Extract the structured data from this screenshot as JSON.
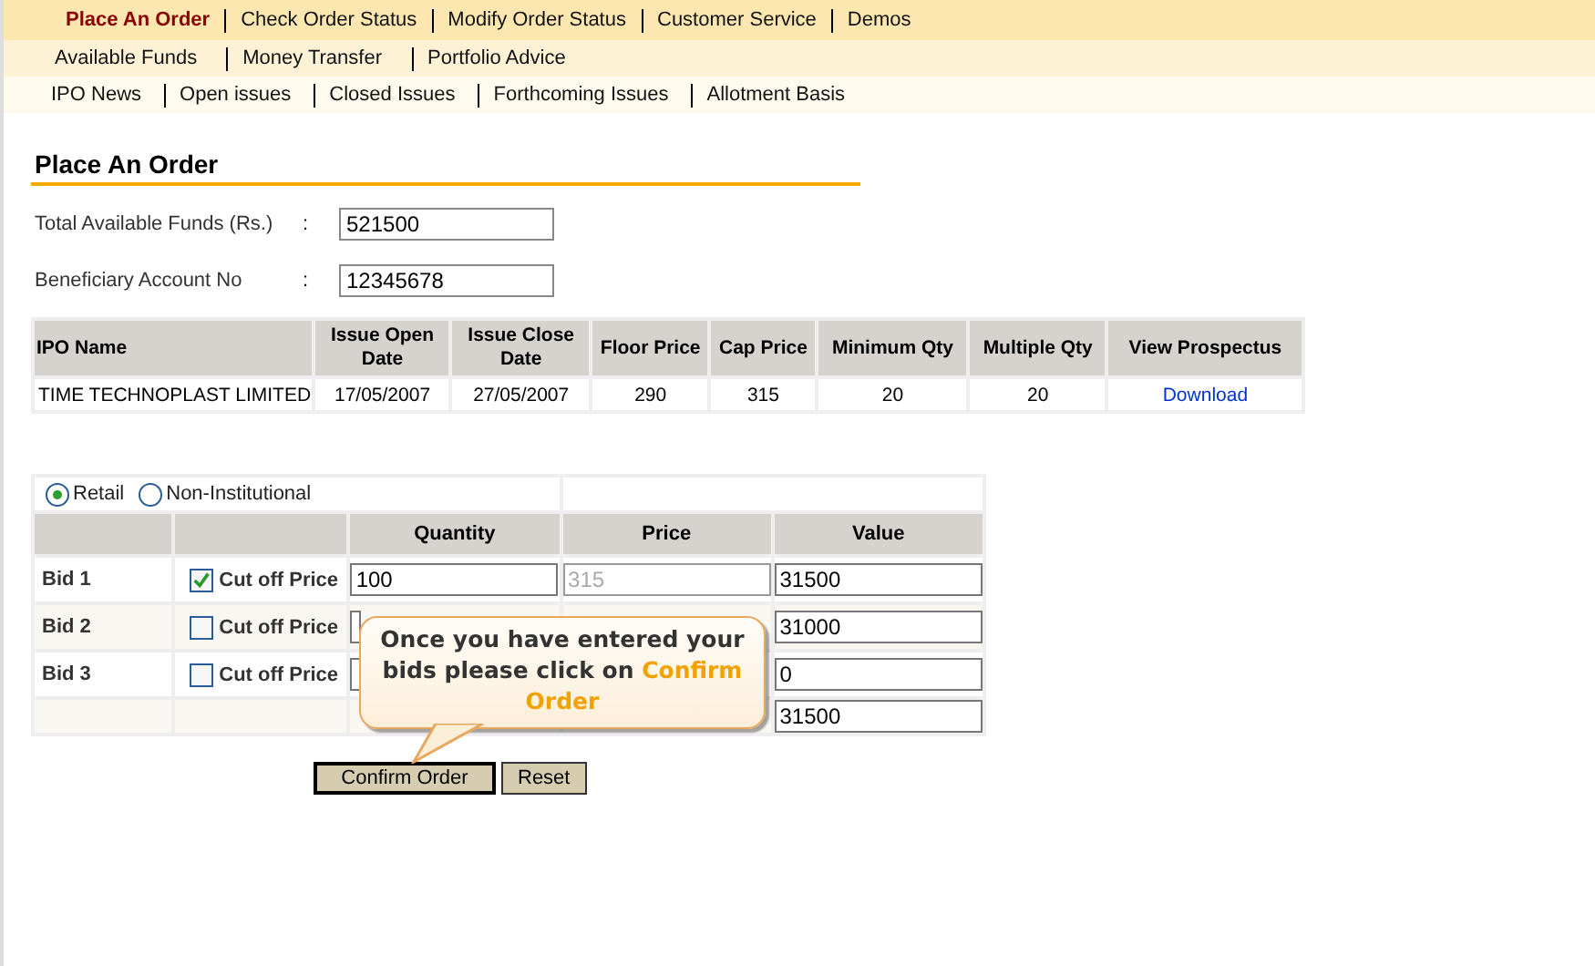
{
  "nav_primary": [
    {
      "label": "Place An Order",
      "selected": true
    },
    {
      "label": "Check Order Status",
      "selected": false
    },
    {
      "label": "Modify Order Status",
      "selected": false
    },
    {
      "label": "Customer Service",
      "selected": false
    },
    {
      "label": "Demos",
      "selected": false
    }
  ],
  "nav_secondary": [
    "Available Funds",
    "Money Transfer",
    "Portfolio Advice"
  ],
  "nav_tertiary": [
    "IPO News",
    "Open issues",
    "Closed Issues",
    "Forthcoming Issues",
    "Allotment Basis"
  ],
  "heading": "Place An Order",
  "fields": [
    {
      "label": "Total Available Funds (Rs.)",
      "separator": ":",
      "value": "521500"
    },
    {
      "label": "Beneficiary Account No",
      "separator": ":",
      "value": "12345678"
    }
  ],
  "ipo_table": {
    "columns": [
      "IPO Name",
      "Issue Open Date",
      "Issue Close Date",
      "Floor Price",
      "Cap Price",
      "Minimum Qty",
      "Multiple Qty",
      "View Prospectus"
    ],
    "rows": [
      {
        "cells": [
          "TIME TECHNOPLAST LIMITED",
          "17/05/2007",
          "27/05/2007",
          "290",
          "315",
          "20",
          "20"
        ],
        "link": "Download"
      }
    ]
  },
  "bid_form": {
    "investor_types": [
      {
        "label": "Retail",
        "selected": true
      },
      {
        "label": "Non-Institutional",
        "selected": false
      }
    ],
    "columns": [
      "Quantity",
      "Price",
      "Value"
    ],
    "bids": [
      {
        "label": "Bid 1",
        "cut_off_label": "Cut off Price",
        "checked": true,
        "quantity": "100",
        "price": "315",
        "value": "31500"
      },
      {
        "label": "Bid 2",
        "cut_off_label": "Cut off Price",
        "checked": false,
        "value": "31000"
      },
      {
        "label": "Bid 3",
        "cut_off_label": "Cut off Price",
        "checked": false,
        "value": "0"
      }
    ],
    "total_value": "31500"
  },
  "callout": {
    "text": "Once you have entered your bids please click on",
    "highlight": "Confirm Order"
  },
  "buttons": [
    {
      "label": "Confirm Order",
      "kind": "primary"
    },
    {
      "label": "Reset",
      "kind": "secondary"
    }
  ]
}
